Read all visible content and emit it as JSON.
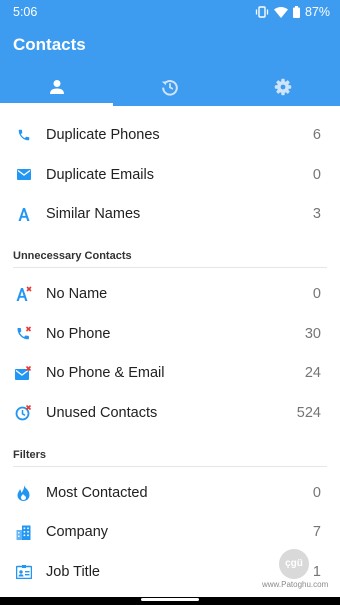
{
  "status_bar": {
    "time": "5:06",
    "battery": "87%"
  },
  "app": {
    "title": "Contacts",
    "accent_color": "#3d9bf0",
    "icon_color": "#2196f3",
    "badge_color": "#e53935"
  },
  "tabs": [
    {
      "icon": "person-icon",
      "active": true
    },
    {
      "icon": "history-icon",
      "active": false
    },
    {
      "icon": "gear-icon",
      "active": false
    }
  ],
  "duplicates": [
    {
      "icon": "phone-icon",
      "label": "Duplicate Phones",
      "count": "6"
    },
    {
      "icon": "email-icon",
      "label": "Duplicate Emails",
      "count": "0"
    },
    {
      "icon": "letter-a-icon",
      "label": "Similar Names",
      "count": "3"
    }
  ],
  "unnecessary": {
    "header": "Unnecessary Contacts",
    "items": [
      {
        "icon": "letter-a-x-icon",
        "label": "No Name",
        "count": "0"
      },
      {
        "icon": "phone-x-icon",
        "label": "No Phone",
        "count": "30"
      },
      {
        "icon": "email-x-icon",
        "label": "No Phone & Email",
        "count": "24"
      },
      {
        "icon": "clock-x-icon",
        "label": "Unused Contacts",
        "count": "524"
      }
    ]
  },
  "filters": {
    "header": "Filters",
    "items": [
      {
        "icon": "flame-icon",
        "label": "Most Contacted",
        "count": "0"
      },
      {
        "icon": "building-icon",
        "label": "Company",
        "count": "7"
      },
      {
        "icon": "id-card-icon",
        "label": "Job Title",
        "count": "1"
      }
    ]
  },
  "watermark": {
    "logo_text": "çgü",
    "text": "www.Patoghu.com"
  }
}
